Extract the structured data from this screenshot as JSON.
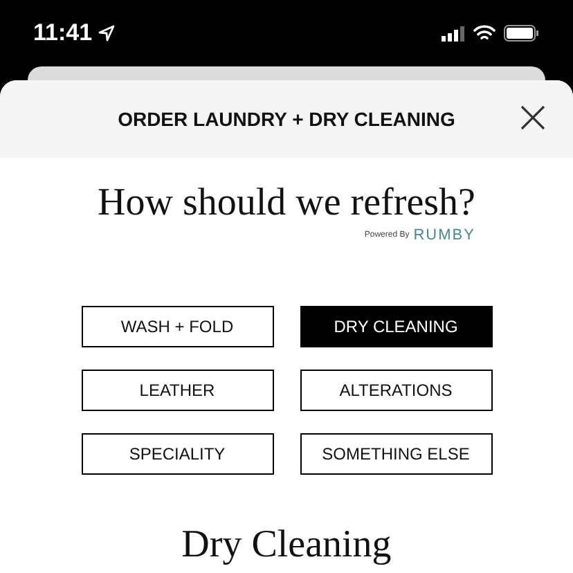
{
  "status_bar": {
    "time": "11:41"
  },
  "sheet": {
    "title": "ORDER LAUNDRY + DRY CLEANING"
  },
  "heading": "How should we refresh?",
  "powered_by": {
    "label": "Powered By",
    "brand": "RUMBY"
  },
  "options": [
    {
      "label": "WASH + FOLD",
      "selected": false
    },
    {
      "label": "DRY CLEANING",
      "selected": true
    },
    {
      "label": "LEATHER",
      "selected": false
    },
    {
      "label": "ALTERATIONS",
      "selected": false
    },
    {
      "label": "SPECIALITY",
      "selected": false
    },
    {
      "label": "SOMETHING ELSE",
      "selected": false
    }
  ],
  "section_title": "Dry Cleaning"
}
